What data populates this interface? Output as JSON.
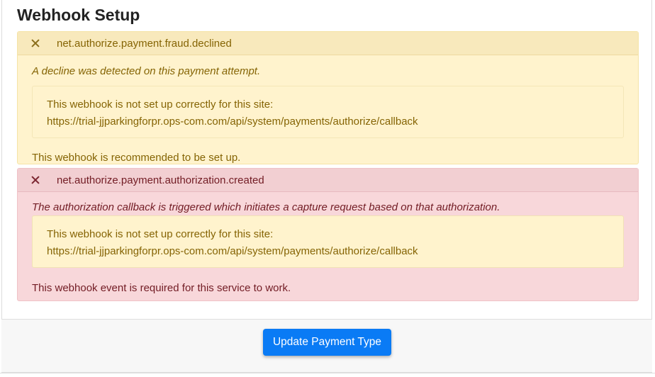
{
  "page": {
    "title": "Webhook Setup"
  },
  "webhooks": [
    {
      "status": "warning",
      "status_icon": "close-icon",
      "event_name": "net.authorize.payment.fraud.declined",
      "description": "A decline was detected on this payment attempt.",
      "alert_line1": "This webhook is not set up correctly for this site:",
      "alert_line2": "https://trial-jjparkingforpr.ops-com.com/api/system/payments/authorize/callback",
      "note": "This webhook is recommended to be set up."
    },
    {
      "status": "danger",
      "status_icon": "close-icon",
      "event_name": "net.authorize.payment.authorization.created",
      "description": "The authorization callback is triggered which initiates a capture request based on that authorization.",
      "alert_line1": "This webhook is not set up correctly for this site:",
      "alert_line2": "https://trial-jjparkingforpr.ops-com.com/api/system/payments/authorize/callback",
      "note": "This webhook event is required for this service to work."
    }
  ],
  "footer": {
    "update_button_label": "Update Payment Type"
  },
  "colors": {
    "warning_bg": "#fff3cd",
    "warning_text": "#856404",
    "danger_bg": "#f8d7da",
    "danger_text": "#721c24",
    "primary_button": "#0a7bf5"
  }
}
